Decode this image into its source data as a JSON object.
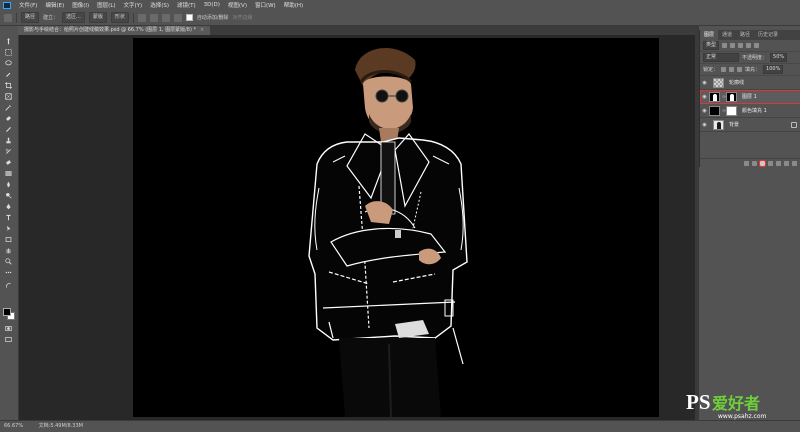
{
  "menubar": {
    "items": [
      "文件(F)",
      "编辑(E)",
      "图像(I)",
      "图层(L)",
      "文字(Y)",
      "选择(S)",
      "滤镜(T)",
      "3D(D)",
      "视图(V)",
      "窗口(W)",
      "帮助(H)"
    ]
  },
  "options": {
    "mode_select": "路径",
    "make_label": "建立：",
    "selection_btn": "选区...",
    "mask_btn": "蒙版",
    "shape_btn": "形状",
    "auto_add_label": "自动添加/删除",
    "align_edges_label": "对齐边缘"
  },
  "document_tab": {
    "title": "摄影与手绘结合：给照片创建线稿效果.psd @ 66.7% (图层 1, 图层蒙版/8) *",
    "close": "×"
  },
  "status": {
    "zoom": "66.67%",
    "doc_info": "文档:5.49M/8.33M"
  },
  "layers_panel": {
    "tabs": [
      "图层",
      "通道",
      "路径",
      "历史记录"
    ],
    "filter_select": "类型",
    "blend_mode": "正常",
    "opacity_label": "不透明度：",
    "opacity_value": "50%",
    "lock_label": "锁定：",
    "fill_label": "填充：",
    "fill_value": "100%",
    "layers": [
      {
        "name": "轮廓线",
        "visible": true
      },
      {
        "name": "图层 1",
        "visible": true,
        "selected": true
      },
      {
        "name": "颜色填充 1",
        "visible": true
      },
      {
        "name": "背景",
        "visible": true,
        "locked": true
      }
    ]
  },
  "watermark": {
    "logo": "PS",
    "title": "爱好者",
    "url": "www.psahz.com"
  },
  "colors": {
    "ui_gray": "#535353",
    "canvas": "#000000",
    "highlight": "#d43a3a",
    "watermark_green": "#6fcf3a"
  }
}
